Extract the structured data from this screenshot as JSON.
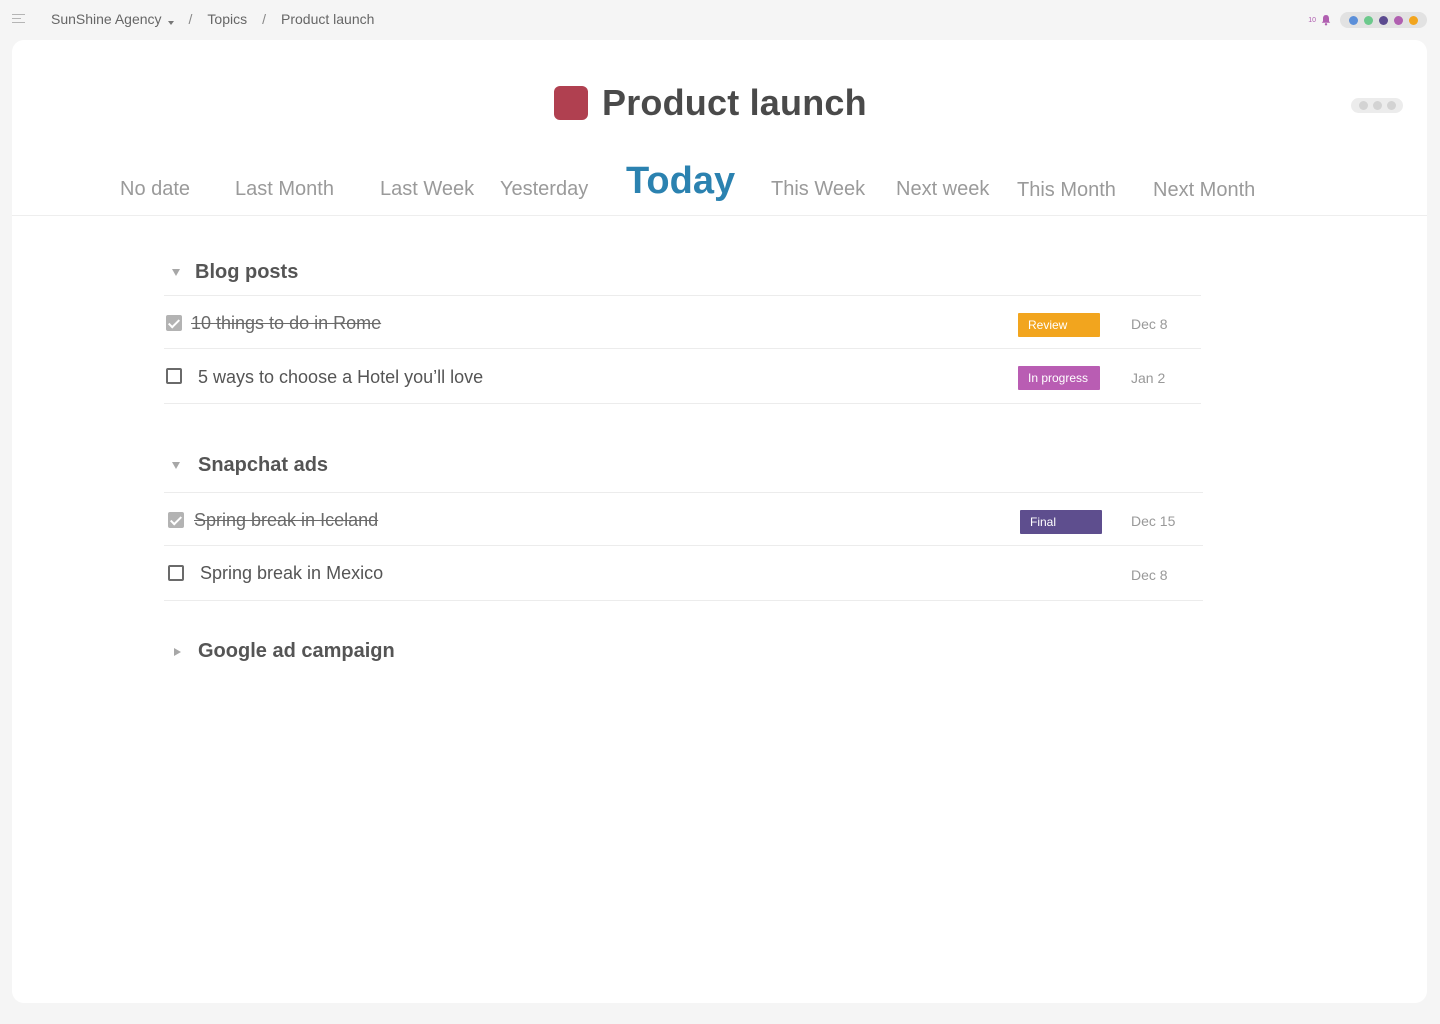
{
  "topbar": {
    "workspace": "SunShine Agency",
    "separator": "/",
    "crumb_topics": "Topics",
    "crumb_current": "Product launch",
    "notification_count": "10",
    "member_colors": [
      "#5b8fd9",
      "#6cc98c",
      "#5b4a8f",
      "#b05fb0",
      "#f2a51e"
    ]
  },
  "page": {
    "title": "Product launch",
    "title_color": "#b04050"
  },
  "tabs": [
    {
      "label": "No date"
    },
    {
      "label": "Last Month"
    },
    {
      "label": "Last Week"
    },
    {
      "label": "Yesterday"
    },
    {
      "label": "Today",
      "active": true
    },
    {
      "label": "This Week"
    },
    {
      "label": "Next week"
    },
    {
      "label": "This Month"
    },
    {
      "label": "Next Month"
    }
  ],
  "sections": [
    {
      "title": "Blog posts",
      "expanded": true,
      "tasks": [
        {
          "title": "10 things to do in Rome",
          "done": true,
          "status": "Review",
          "status_color": "#f2a51e",
          "due": "Dec 8"
        },
        {
          "title": "5 ways to choose a Hotel you’ll love",
          "done": false,
          "status": "In progress",
          "status_color": "#b95db3",
          "due": "Jan 2"
        }
      ]
    },
    {
      "title": "Snapchat ads",
      "expanded": true,
      "tasks": [
        {
          "title": "Spring break in Iceland",
          "done": true,
          "status": "Final",
          "status_color": "#5e4e8e",
          "due": "Dec 15"
        },
        {
          "title": "Spring break in Mexico",
          "done": false,
          "status": "",
          "due": "Dec 8"
        }
      ]
    },
    {
      "title": "Google ad campaign",
      "expanded": false,
      "tasks": []
    }
  ]
}
